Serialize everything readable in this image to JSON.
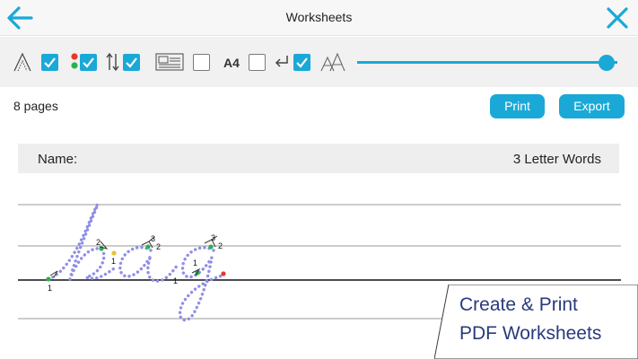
{
  "header": {
    "title": "Worksheets",
    "back_icon": "arrow-left-icon",
    "close_icon": "close-icon",
    "accent": "#1aa9d6"
  },
  "toolbar": {
    "tools": [
      {
        "icon": "letter-outline-icon",
        "checked": true
      },
      {
        "icon": "color-dots-icon",
        "checked": true
      },
      {
        "icon": "stroke-direction-icon",
        "checked": true
      },
      {
        "icon": "text-layout-icon",
        "checked": false
      },
      {
        "icon": "a4-paper-icon",
        "checked": false
      },
      {
        "icon": "return-icon",
        "checked": true
      },
      {
        "icon": "letter-size-icon"
      }
    ],
    "a4_label": "A4",
    "size_slider_value": 0.95
  },
  "info": {
    "page_count": "8 pages",
    "print_label": "Print",
    "export_label": "Export"
  },
  "worksheet": {
    "name_label": "Name:",
    "title": "3 Letter Words",
    "word": "bag",
    "stroke_numbers": [
      "1",
      "2",
      "1",
      "3",
      "2",
      "1",
      "3",
      "2",
      "1"
    ]
  },
  "promo": {
    "line1": "Create & Print",
    "line2": "PDF Worksheets"
  }
}
